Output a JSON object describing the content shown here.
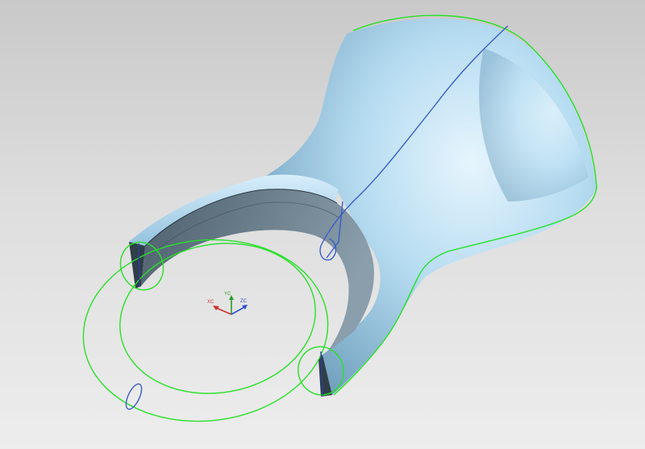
{
  "viewport": {
    "name": "graphics-window",
    "background": "#dcdcdc"
  },
  "model": {
    "surface_color": "#a9d4ec",
    "inner_wall_color": "#5b6d7a",
    "edge_highlight_color": "#28e028",
    "guide_curve_color": "#3a5ec8"
  },
  "triad": {
    "x_label": "XC",
    "y_label": "YC",
    "z_label": "ZC",
    "x_color": "#d03030",
    "y_color": "#2e9a2e",
    "z_color": "#2e4fcf"
  }
}
